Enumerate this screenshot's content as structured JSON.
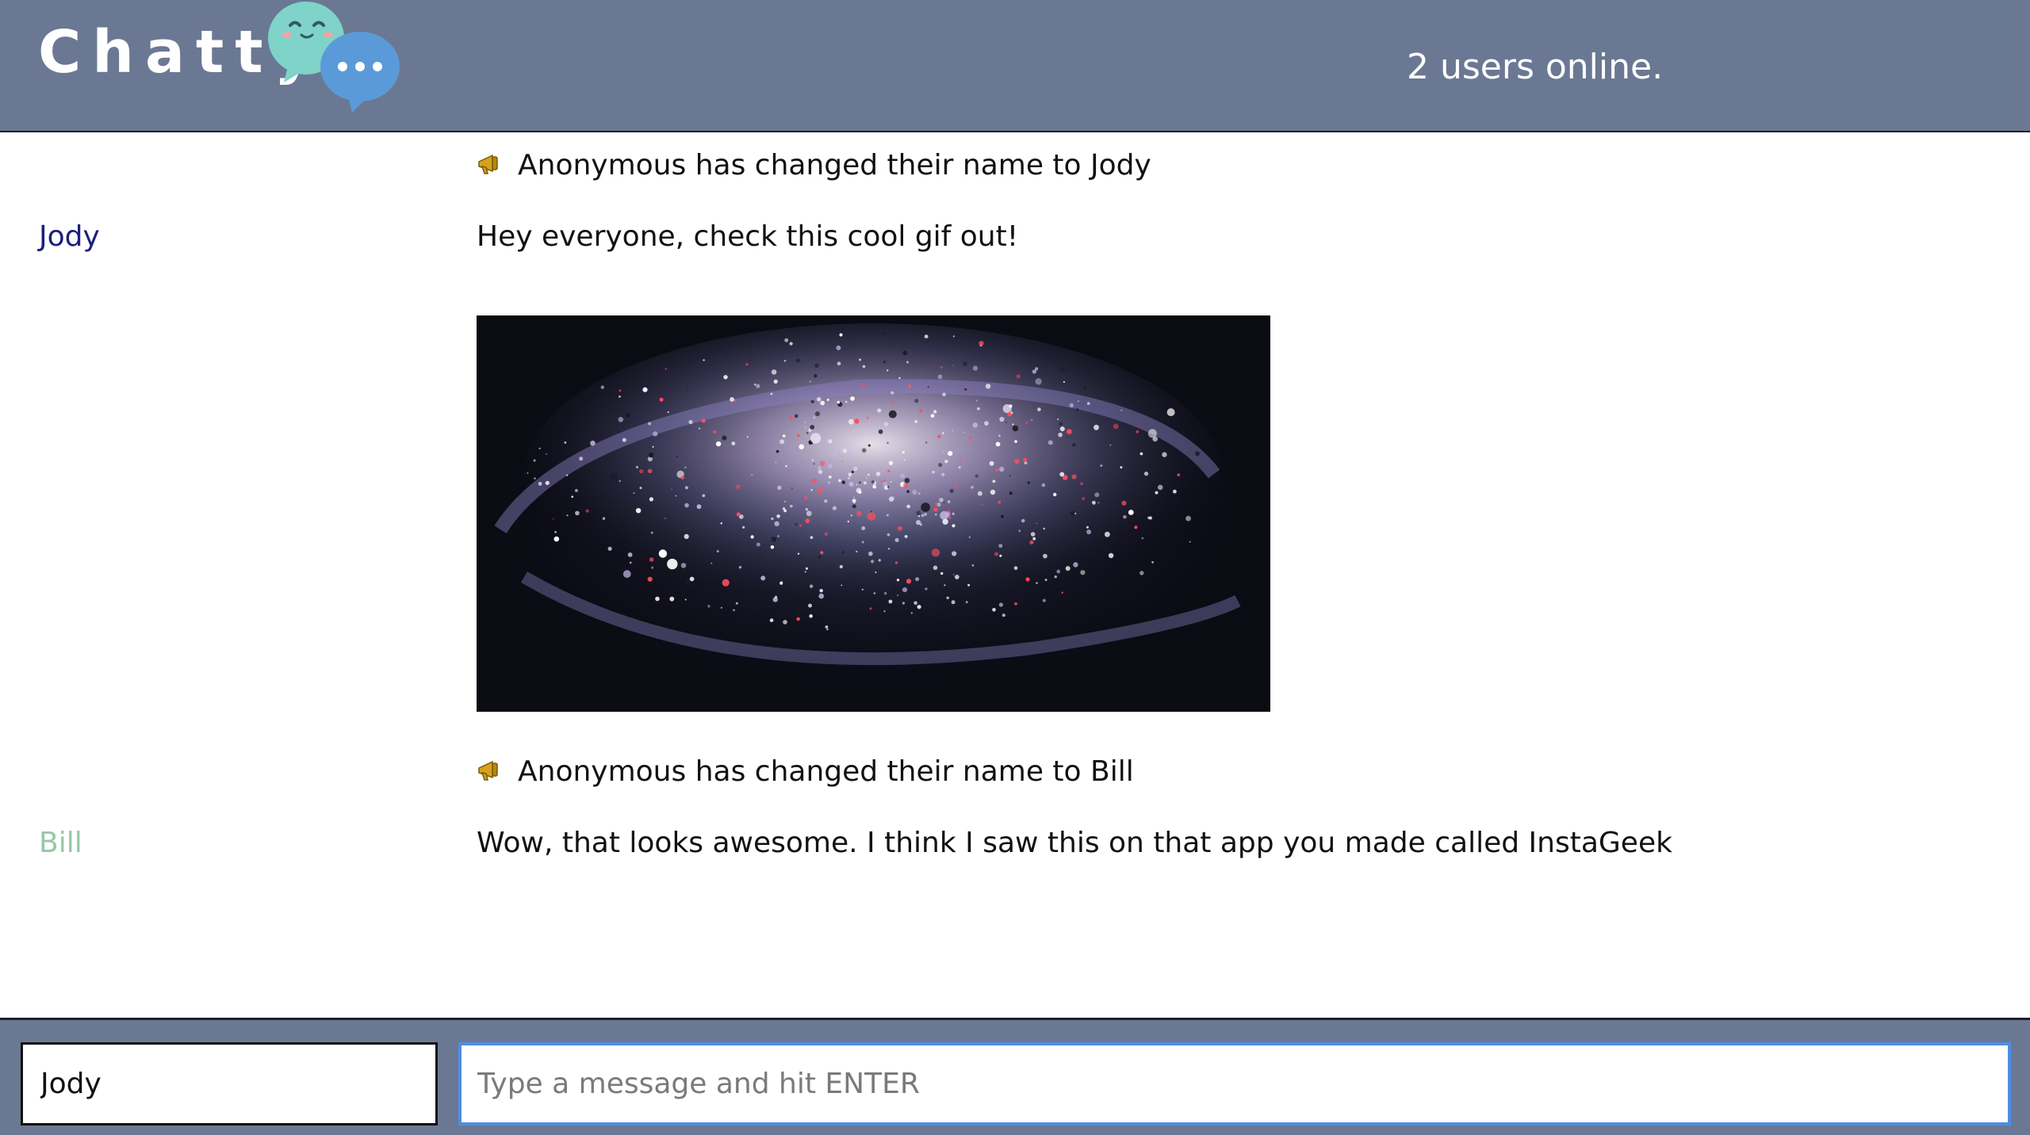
{
  "navbar": {
    "brand": "Chatty",
    "user_count": "2 users online."
  },
  "messages": [
    {
      "kind": "notification",
      "text": "Anonymous has changed their name to Jody",
      "icon": "megaphone-icon"
    },
    {
      "kind": "message",
      "username": "Jody",
      "username_color": "#1a1f7a",
      "text": "Hey everyone, check this cool gif out!"
    },
    {
      "kind": "image",
      "alt": "galaxy gif"
    },
    {
      "kind": "notification",
      "text": "Anonymous has changed their name to Bill",
      "icon": "megaphone-icon"
    },
    {
      "kind": "message",
      "username": "Bill",
      "username_color": "#95c9a6",
      "text": "Wow, that looks awesome. I think I saw this on that app you made called InstaGeek"
    }
  ],
  "chatbar": {
    "username_value": "Jody",
    "message_placeholder": "Type a message and hit ENTER"
  },
  "colors": {
    "bar": "#6b7893",
    "input_focus": "#4f8de2"
  }
}
